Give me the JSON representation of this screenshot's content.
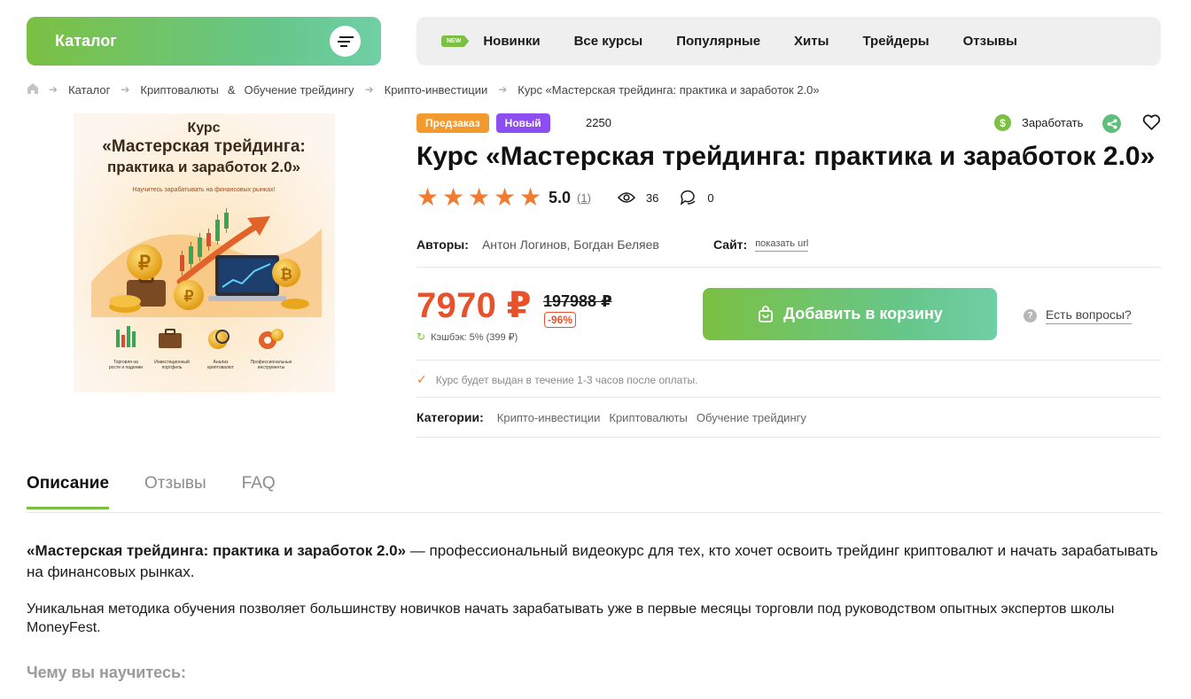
{
  "header": {
    "catalog_label": "Каталог",
    "new_badge": "NEW",
    "nav": [
      "Новинки",
      "Все курсы",
      "Популярные",
      "Хиты",
      "Трейдеры",
      "Отзывы"
    ]
  },
  "breadcrumb": {
    "items": [
      "Каталог",
      "Криптовалюты",
      "&",
      "Обучение трейдингу",
      "Крипто-инвестиции",
      "Курс «Мастерская трейдинга: практика и заработок 2.0»"
    ]
  },
  "cover": {
    "line1": "Курс",
    "line2": "«Мастерская трейдинга:",
    "line3": "практика и заработок 2.0»",
    "tagline": "Научитесь зарабатывать на финансовых рынках!",
    "features": [
      "Торговля на росте и падении",
      "Инвестиционный портфель",
      "Анализ криптовалют",
      "Профессиональные инструменты"
    ]
  },
  "product": {
    "badge_preorder": "Предзаказ",
    "badge_new": "Новый",
    "code": "2250",
    "earn_label": "Заработать",
    "title": "Курс «Мастерская трейдинга: практика и заработок 2.0»",
    "rating": "5.0",
    "rating_count": "(1)",
    "stars": 5,
    "views": "36",
    "comments": "0",
    "authors_label": "Авторы:",
    "authors": "Антон Логинов, Богдан Беляев",
    "site_label": "Сайт:",
    "site_value": "показать url",
    "price": "7970 ₽",
    "old_price": "197988 ₽",
    "discount": "-96%",
    "cashback": "Кэшбэк: 5% (399 ₽)",
    "cart_label": "Добавить в корзину",
    "questions_label": "Есть вопросы?",
    "delivery_note": "Курс будет выдан в течение 1-3 часов после оплаты.",
    "categories_label": "Категории:",
    "categories": [
      "Крипто-инвестиции",
      "Криптовалюты",
      "Обучение трейдингу"
    ]
  },
  "tabs": [
    "Описание",
    "Отзывы",
    "FAQ"
  ],
  "description": {
    "p1_bold": "«Мастерская трейдинга: практика и заработок 2.0»",
    "p1_rest": " — профессиональный видеокурс для тех, кто хочет освоить трейдинг криптовалют и начать зарабатывать на финансовых рынках.",
    "p2": "Уникальная методика обучения позволяет большинству новичков начать зарабатывать уже в первые месяцы торговли под руководством опытных экспертов школы MoneyFest.",
    "learn_heading": "Чему вы научитесь:"
  },
  "colors": {
    "accent_green": "#7bc043",
    "price_red": "#e8522b",
    "star_orange": "#f07c32",
    "preorder_orange": "#f29a2e",
    "new_purple": "#8c4ef0"
  }
}
